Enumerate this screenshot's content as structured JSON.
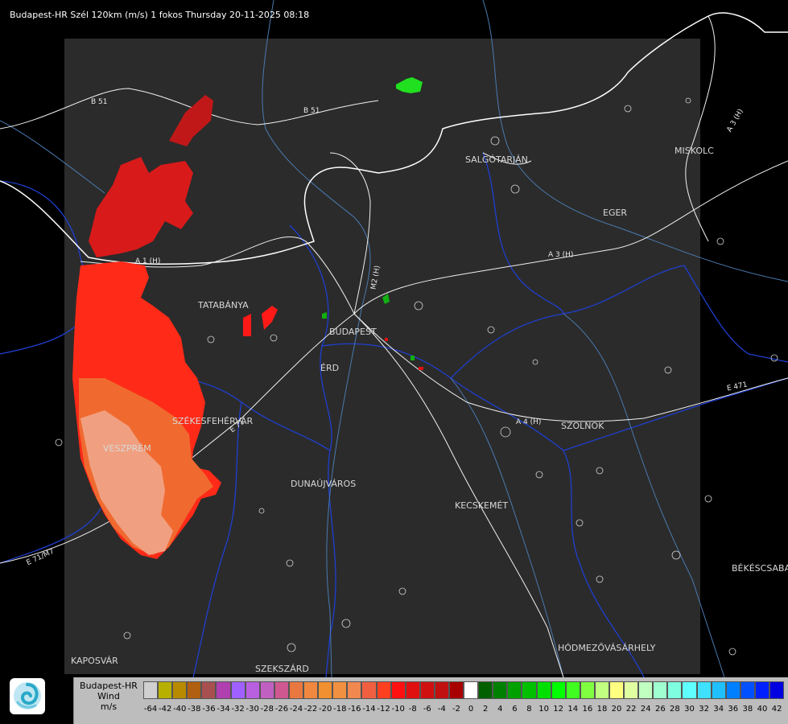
{
  "header": {
    "title": "Budapest-HR Szél 120km (m/s) 1 fokos Thursday 20-11-2025 08:18"
  },
  "map": {
    "background_color": "#000000",
    "coverage_color": "#2b2b2b",
    "border_color": "#ffffff",
    "river_color": "#1f3fd0",
    "road_color": "#f0f0f0",
    "cities": [
      {
        "name": "SALGÓTARJÁN"
      },
      {
        "name": "MISKOLC"
      },
      {
        "name": "EGER"
      },
      {
        "name": "TATABÁNYA"
      },
      {
        "name": "BUDAPEST"
      },
      {
        "name": "ÉRD"
      },
      {
        "name": "SZÉKESFEHÉRVÁR"
      },
      {
        "name": "VESZPRÉM"
      },
      {
        "name": "DUNAÚJVÁROS"
      },
      {
        "name": "KECSKEMÉT"
      },
      {
        "name": "SZOLNOK"
      },
      {
        "name": "BÉKÉSCSABA"
      },
      {
        "name": "HÓDMEZŐVÁSÁRHELY"
      },
      {
        "name": "KAPOSVÁR"
      },
      {
        "name": "SZEKSZÁRD"
      }
    ],
    "roads": [
      {
        "name": "B 51"
      },
      {
        "name": "B 51"
      },
      {
        "name": "A 3 (H)"
      },
      {
        "name": "A 3 (H)"
      },
      {
        "name": "A 1 (H)"
      },
      {
        "name": "M2 (H)"
      },
      {
        "name": "A 4 (H)"
      },
      {
        "name": "E 471"
      },
      {
        "name": "E 71"
      },
      {
        "name": "E 71/M7"
      }
    ]
  },
  "legend": {
    "title_lines": [
      "Budapest-HR",
      "Wind",
      "m/s"
    ],
    "labels": [
      "-64",
      "-42",
      "-40",
      "-38",
      "-36",
      "-34",
      "-32",
      "-30",
      "-28",
      "-26",
      "-24",
      "-22",
      "-20",
      "-18",
      "-16",
      "-14",
      "-12",
      "-10",
      "-8",
      "-6",
      "-4",
      "-2",
      "0",
      "2",
      "4",
      "6",
      "8",
      "10",
      "12",
      "14",
      "16",
      "18",
      "20",
      "22",
      "24",
      "26",
      "28",
      "30",
      "32",
      "34",
      "36",
      "38",
      "40",
      "42"
    ],
    "colors": [
      "#d0d0d0",
      "#b8b000",
      "#b88a00",
      "#b06010",
      "#a85050",
      "#b040b0",
      "#a060ff",
      "#b860e0",
      "#c060c0",
      "#d05890",
      "#e87840",
      "#f08840",
      "#f09030",
      "#f09040",
      "#f08850",
      "#f06040",
      "#ff4020",
      "#ff1010",
      "#e01010",
      "#d01010",
      "#c01010",
      "#a80000",
      "#ffffff",
      "#006000",
      "#008000",
      "#00a000",
      "#00c000",
      "#00e000",
      "#00ff00",
      "#40ff20",
      "#80ff40",
      "#c0ff80",
      "#ffff80",
      "#e0ffa0",
      "#c0ffc0",
      "#a0ffd0",
      "#80ffe0",
      "#60ffff",
      "#40e0ff",
      "#20c0ff",
      "#0080ff",
      "#0050ff",
      "#0020ff",
      "#0000e0"
    ]
  }
}
